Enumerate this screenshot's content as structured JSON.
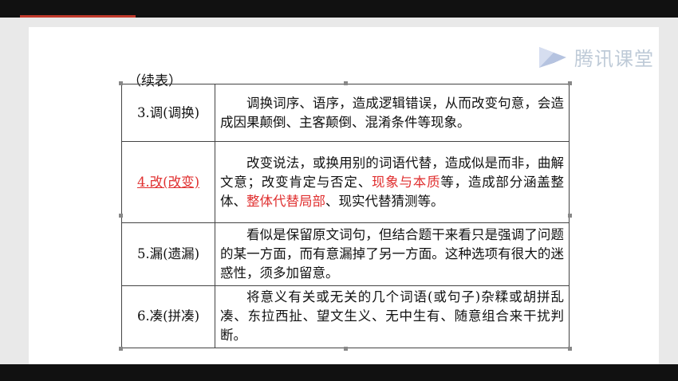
{
  "watermark": {
    "brand_text": "腾讯课堂",
    "logo_icon": "play-triangle-icon"
  },
  "table": {
    "caption": "（续表）",
    "rows": [
      {
        "label": "3.调(调换)",
        "desc": "调换词序、语序，造成逻辑错误，从而改变句意，会造成因果颠倒、主客颠倒、混淆条件等现象。"
      },
      {
        "label": "4.改(改变)",
        "desc_a": "改变说法，或换用别的词语代替，造成似是而非，曲解文意；改变肯定与否定、",
        "desc_hl1": "现象与本质",
        "desc_b": "等，造成部分涵盖整体、",
        "desc_hl2": "整体代替局部",
        "desc_c": "、现实代替猜测等。"
      },
      {
        "label": "5.漏(遗漏)",
        "desc": "看似是保留原文词句，但结合题干来看只是强调了问题的某一方面，而有意漏掉了另一方面。这种选项有很大的迷惑性，须多加留意。"
      },
      {
        "label": "6.凑(拼凑)",
        "desc": "将意义有关或无关的几个词语(或句子)杂糅或胡拼乱凑、东拉西扯、望文生义、无中生有、随意组合来干扰判断。"
      }
    ]
  },
  "colors": {
    "highlight": "#e03030",
    "accent": "#c0392b"
  }
}
